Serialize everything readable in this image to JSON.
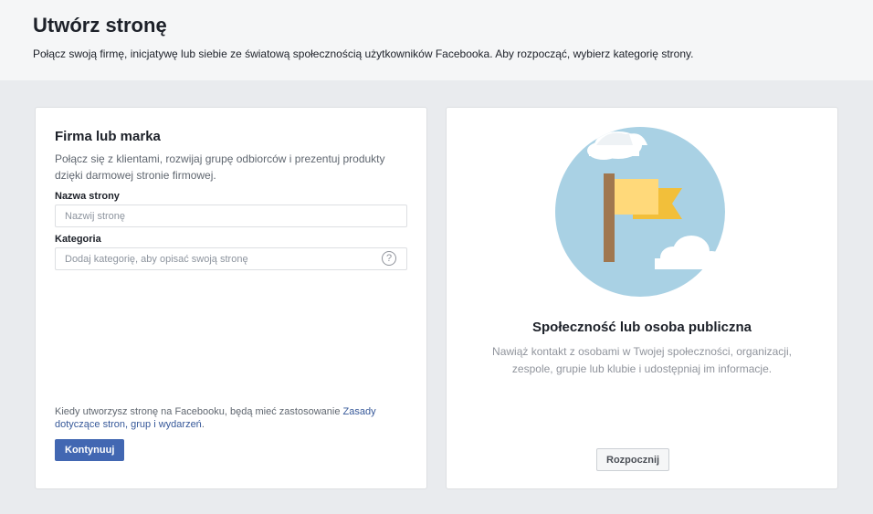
{
  "header": {
    "title": "Utwórz stronę",
    "subtitle": "Połącz swoją firmę, inicjatywę lub siebie ze światową społecznością użytkowników Facebooka. Aby rozpocząć, wybierz kategorię strony."
  },
  "business_card": {
    "title": "Firma lub marka",
    "description": "Połącz się z klientami, rozwijaj grupę odbiorców i prezentuj produkty dzięki darmowej stronie firmowej.",
    "page_name_label": "Nazwa strony",
    "page_name_value": "",
    "page_name_placeholder": "Nazwij stronę",
    "category_label": "Kategoria",
    "category_value": "",
    "category_placeholder": "Dodaj kategorię, aby opisać swoją stronę",
    "help_icon": "?",
    "terms_prefix": "Kiedy utworzysz stronę na Facebooku, będą mieć zastosowanie ",
    "terms_link": "Zasady dotyczące stron, grup i wydarzeń",
    "terms_suffix": ".",
    "continue_label": "Kontynuuj"
  },
  "community_card": {
    "title": "Społeczność lub osoba publiczna",
    "description": "Nawiąż kontakt z osobami w Twojej społeczności, organizacji, zespole, grupie lub klubie i udostępniaj im informacje.",
    "start_label": "Rozpocznij",
    "illustration": "flag-illustration"
  },
  "colors": {
    "background": "#e9ebee",
    "primary_button": "#4267b2",
    "link": "#365899",
    "circle": "#a9d1e4",
    "flag_light": "#ffd97a",
    "flag_dark": "#f2bf3a",
    "pole": "#a0774f"
  }
}
